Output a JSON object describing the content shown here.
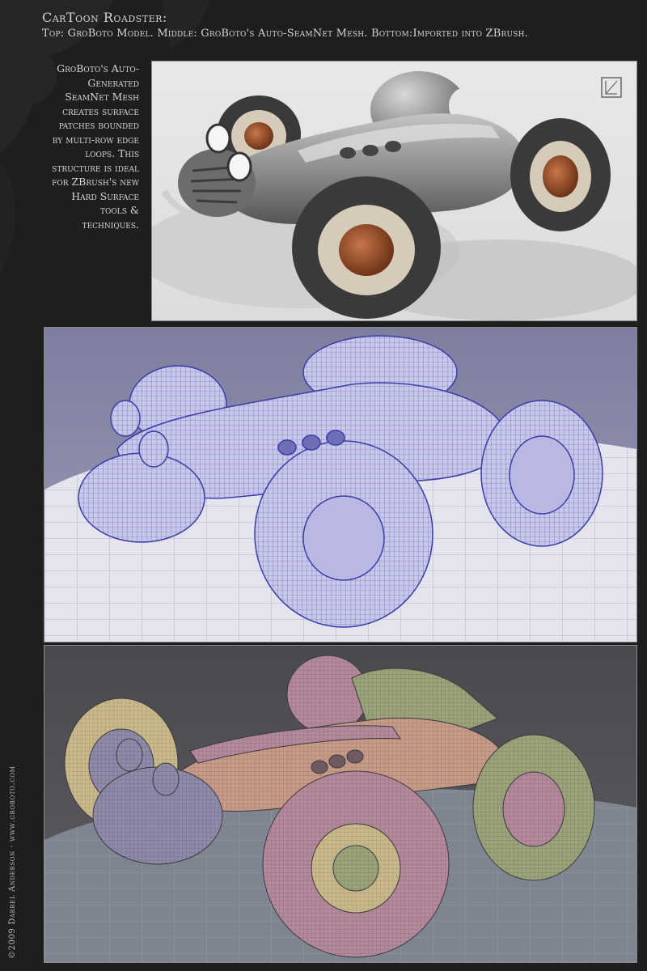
{
  "header": {
    "title": "CarToon Roadster:",
    "subtitle": "Top: GroBoto Model.   Middle: GroBoto's Auto-SeamNet Mesh.  Bottom:Imported into ZBrush."
  },
  "description": {
    "lines": [
      "GroBoto's Auto-",
      "Generated",
      "SeamNet Mesh",
      "creates surface",
      "patches bounded",
      "by multi-row edge",
      "loops. This",
      "structure is ideal",
      "for ZBrush's new",
      "Hard Surface",
      "tools &",
      "techniques."
    ]
  },
  "credit": "©2009 Darrel Anderson · www.groboto.com",
  "panels": {
    "top": {
      "icon": "groboto-logo-icon",
      "background": "#e4e4e4",
      "car_body": "#8e8e8e",
      "hub": "#a0522d"
    },
    "middle": {
      "background": "#8c8cab",
      "mesh": "#5b5bd0"
    },
    "bottom": {
      "background": "#555559",
      "patch_colors": [
        "#c9b98a",
        "#b4899b",
        "#9aa37a",
        "#8e8aa8",
        "#c89a88"
      ]
    }
  }
}
